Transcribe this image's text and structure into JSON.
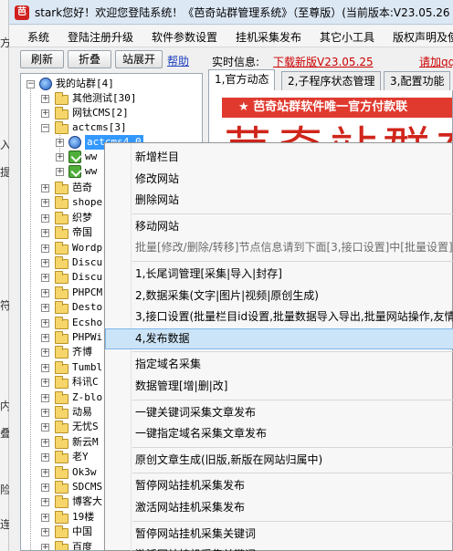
{
  "background_window": {
    "fragments": [
      "方",
      "入",
      "提",
      "符",
      "内",
      "叠",
      "险",
      "连"
    ]
  },
  "window": {
    "title": "stark您好！欢迎您登陆系统！《芭奇站群管理系统》（至尊版）(当前版本:V23.05.26"
  },
  "menu": [
    "系统",
    "登陆注册升级",
    "软件参数设置",
    "挂机采集发布",
    "其它小工具",
    "版权声明及使"
  ],
  "toolbar": {
    "refresh_label": "刷新",
    "collapse_label": "折叠",
    "expand_label": "站展开",
    "help_label": "帮助",
    "info_label": "实时信息:",
    "download_link": "下载新版V23.05.25",
    "add_group_link": "请加qq"
  },
  "tree": {
    "root": "我的站群[4]",
    "groups": [
      "其他测试[30]",
      "网钛CMS[2]",
      "actcms[3]"
    ],
    "selected_site": "actcms4.0",
    "child_sites": [
      "ww",
      "ww"
    ],
    "folders": [
      "芭奇",
      "shope",
      "织梦",
      "帝国",
      "Wordp",
      "Discu",
      "Discu",
      "PHPCM",
      "Desto",
      "Ecsho",
      "PHPWi",
      "齐博",
      "Tumbl",
      "科讯C",
      "Z-blo",
      "动易",
      "无忧S",
      "新云M",
      "老Y",
      "Ok3w",
      "SDCMS",
      "博客大",
      "19楼",
      "中国",
      "百度",
      "新浪"
    ]
  },
  "tabs": [
    {
      "label": "1,官方动态",
      "active": true
    },
    {
      "label": "2,子程序状态管理",
      "active": false
    },
    {
      "label": "3,配置功能",
      "active": false
    }
  ],
  "content": {
    "banner": "★ 芭奇站群软件唯一官方付款联",
    "big_title": "芭奇站群在"
  },
  "context_menu": [
    {
      "label": "新增栏目",
      "type": "item"
    },
    {
      "label": "修改网站",
      "type": "item"
    },
    {
      "label": "删除网站",
      "type": "item"
    },
    {
      "type": "sep"
    },
    {
      "label": "移动网站",
      "type": "item"
    },
    {
      "label": "批量[修改/删除/转移]节点信息请到下面[3,接口设置]中[批量设置]栏",
      "type": "disabled"
    },
    {
      "type": "sep"
    },
    {
      "label": "1,长尾词管理[采集|导入|封存]",
      "type": "item"
    },
    {
      "label": "2,数据采集(文字|图片|视频|原创生成)",
      "type": "item"
    },
    {
      "label": "3,接口设置(批量栏目id设置,批量数据导入导出,批量网站操作,友情链接",
      "type": "item"
    },
    {
      "label": "4,发布数据",
      "type": "highlighted"
    },
    {
      "type": "sep"
    },
    {
      "label": "指定域名采集",
      "type": "item"
    },
    {
      "label": "数据管理[增|删|改]",
      "type": "item"
    },
    {
      "type": "sep"
    },
    {
      "label": "一键关键词采集文章发布",
      "type": "item"
    },
    {
      "label": "一键指定域名采集文章发布",
      "type": "item"
    },
    {
      "type": "sep"
    },
    {
      "label": "原创文章生成(旧版,新版在网站归属中)",
      "type": "item"
    },
    {
      "type": "sep"
    },
    {
      "label": "暂停网站挂机采集发布",
      "type": "item"
    },
    {
      "label": "激活网站挂机采集发布",
      "type": "item"
    },
    {
      "type": "sep"
    },
    {
      "label": "暂停网站挂机采集关键词",
      "type": "item"
    },
    {
      "label": "激活网站挂机采集关键词",
      "type": "item"
    }
  ]
}
